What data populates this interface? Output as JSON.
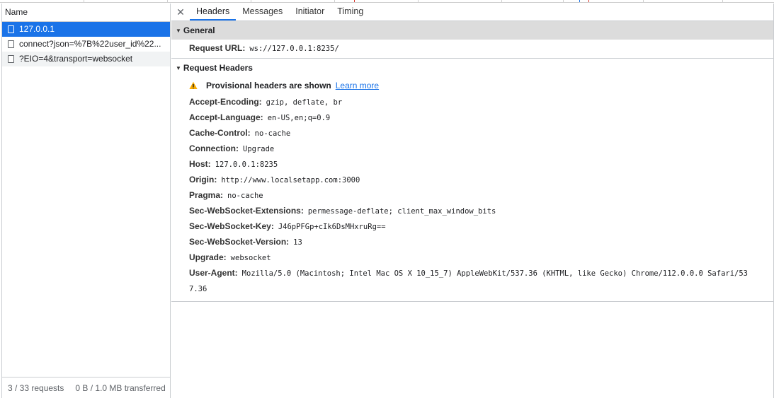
{
  "request_list": {
    "header": "Name",
    "items": [
      {
        "name": "127.0.0.1"
      },
      {
        "name": "connect?json=%7B%22user_id%22..."
      },
      {
        "name": "?EIO=4&transport=websocket"
      }
    ],
    "status": {
      "requests": "3 / 33 requests",
      "transferred": "0 B / 1.0 MB transferred"
    }
  },
  "detail": {
    "close_icon": "close-icon",
    "tabs": [
      {
        "label": "Headers",
        "active": true
      },
      {
        "label": "Messages",
        "active": false
      },
      {
        "label": "Initiator",
        "active": false
      },
      {
        "label": "Timing",
        "active": false
      }
    ],
    "general": {
      "title": "General",
      "request_url_label": "Request URL:",
      "request_url_value": "ws://127.0.0.1:8235/"
    },
    "request_headers": {
      "title": "Request Headers",
      "warning_text": "Provisional headers are shown",
      "learn_more": "Learn more",
      "headers": [
        {
          "name": "Accept-Encoding:",
          "value": "gzip, deflate, br"
        },
        {
          "name": "Accept-Language:",
          "value": "en-US,en;q=0.9"
        },
        {
          "name": "Cache-Control:",
          "value": "no-cache"
        },
        {
          "name": "Connection:",
          "value": "Upgrade"
        },
        {
          "name": "Host:",
          "value": "127.0.0.1:8235"
        },
        {
          "name": "Origin:",
          "value": "http://www.localsetapp.com:3000"
        },
        {
          "name": "Pragma:",
          "value": "no-cache"
        },
        {
          "name": "Sec-WebSocket-Extensions:",
          "value": "permessage-deflate; client_max_window_bits"
        },
        {
          "name": "Sec-WebSocket-Key:",
          "value": "J46pPFGp+cIk6DsMHxruRg=="
        },
        {
          "name": "Sec-WebSocket-Version:",
          "value": "13"
        },
        {
          "name": "Upgrade:",
          "value": "websocket"
        }
      ],
      "user_agent": {
        "name": "User-Agent:",
        "value_line1": "Mozilla/5.0 (Macintosh; Intel Mac OS X 10_15_7) AppleWebKit/537.36 (KHTML, like Gecko) Chrome/112.0.0.0 Safari/53",
        "value_line2": "7.36"
      }
    }
  },
  "colors": {
    "selected_row": "#1a73e8",
    "active_tab_underline": "#1a73e8",
    "warning": "#f9ab00",
    "link": "#1a73e8"
  }
}
